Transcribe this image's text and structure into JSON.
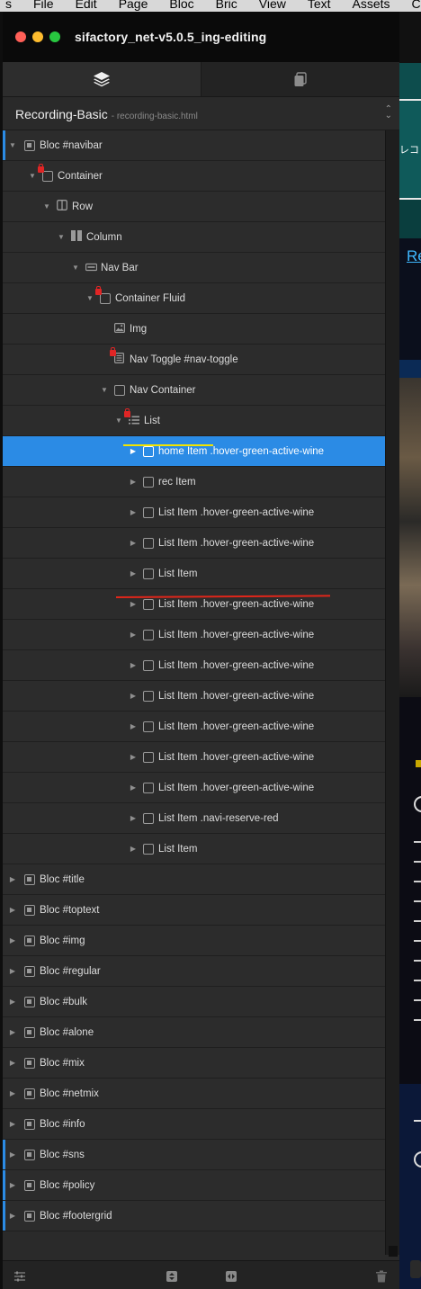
{
  "menubar": {
    "items": [
      "s",
      "File",
      "Edit",
      "Page",
      "Bloc",
      "Bric",
      "View",
      "Text",
      "Assets",
      "Colours"
    ]
  },
  "window": {
    "title": "sifactory_net-v5.0.5_ing-editing"
  },
  "tabs": {
    "layers_icon": "layers-icon",
    "pages_icon": "copy-pages-icon"
  },
  "page_selector": {
    "name": "Recording-Basic",
    "file": "- recording-basic.html"
  },
  "tree": [
    {
      "label": "Bloc #navibar"
    },
    {
      "label": "Container"
    },
    {
      "label": "Row"
    },
    {
      "label": "Column"
    },
    {
      "label": "Nav Bar"
    },
    {
      "label": "Container Fluid"
    },
    {
      "label": "Img"
    },
    {
      "label": "Nav Toggle #nav-toggle"
    },
    {
      "label": "Nav Container"
    },
    {
      "label": "List"
    },
    {
      "label": "home Item .hover-green-active-wine"
    },
    {
      "label": "rec Item"
    },
    {
      "label": "List Item .hover-green-active-wine"
    },
    {
      "label": "List Item .hover-green-active-wine"
    },
    {
      "label": "List Item"
    },
    {
      "label": "List Item .hover-green-active-wine"
    },
    {
      "label": "List Item .hover-green-active-wine"
    },
    {
      "label": "List Item .hover-green-active-wine"
    },
    {
      "label": "List Item .hover-green-active-wine"
    },
    {
      "label": "List Item .hover-green-active-wine"
    },
    {
      "label": "List Item .hover-green-active-wine"
    },
    {
      "label": "List Item .hover-green-active-wine"
    },
    {
      "label": "List Item .navi-reserve-red"
    },
    {
      "label": "List Item"
    },
    {
      "label": "Bloc #title"
    },
    {
      "label": "Bloc #toptext"
    },
    {
      "label": "Bloc #img"
    },
    {
      "label": "Bloc #regular"
    },
    {
      "label": "Bloc #bulk"
    },
    {
      "label": "Bloc #alone"
    },
    {
      "label": "Bloc #mix"
    },
    {
      "label": "Bloc #netmix"
    },
    {
      "label": "Bloc #info"
    },
    {
      "label": "Bloc #sns"
    },
    {
      "label": "Bloc #policy"
    },
    {
      "label": "Bloc #footergrid"
    }
  ],
  "preview": {
    "link_text": "Re",
    "jp_text": "レコ"
  },
  "colors": {
    "selection": "#2b8be5",
    "annotation_yellow": "#f2e400",
    "annotation_red": "#e0261a"
  }
}
